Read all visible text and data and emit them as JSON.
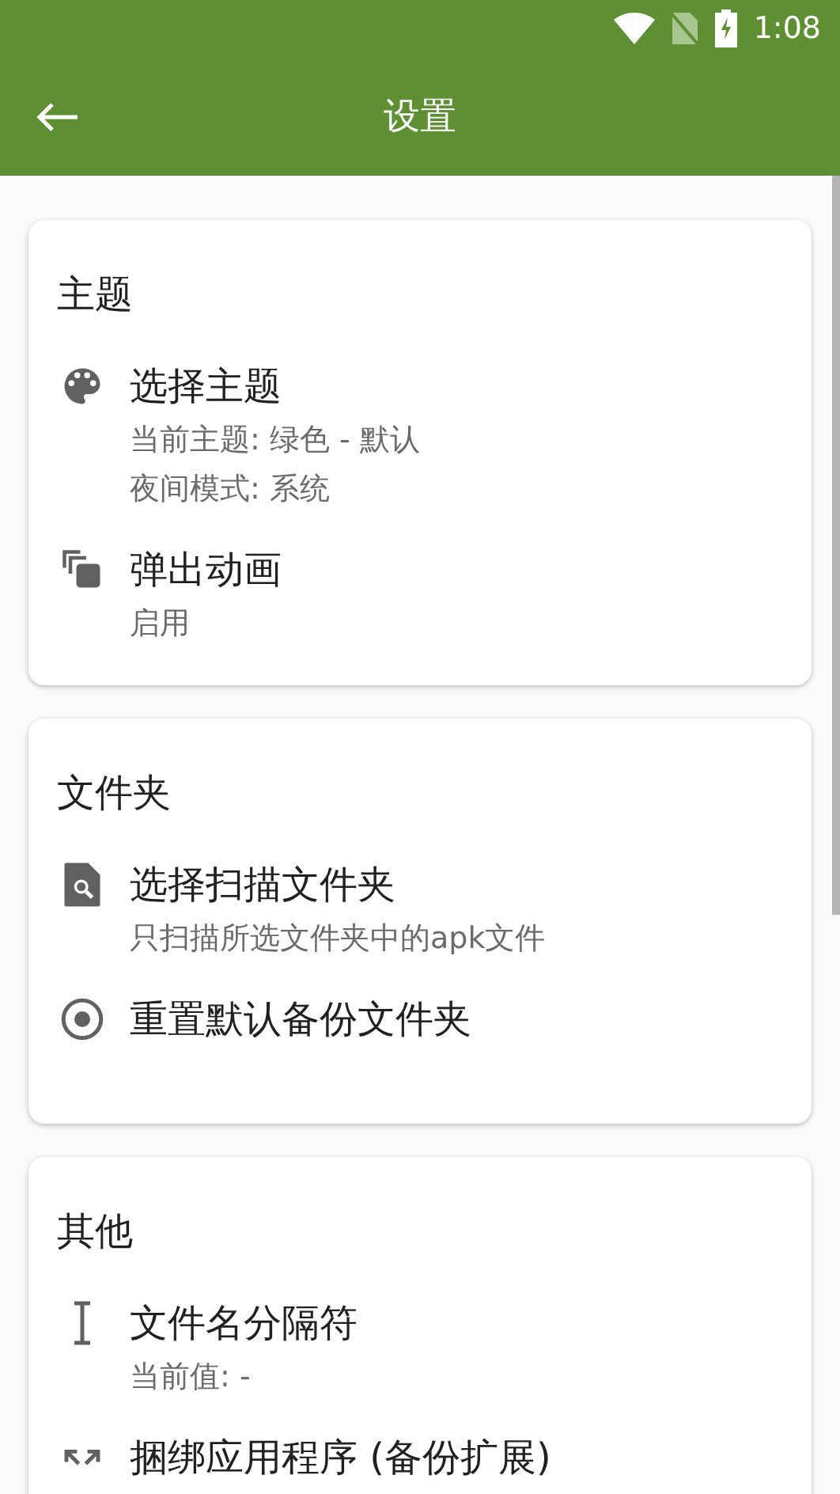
{
  "status_bar": {
    "time": "1:08"
  },
  "toolbar": {
    "title": "设置"
  },
  "sections": [
    {
      "title": "主题",
      "items": [
        {
          "title": "选择主题",
          "subtitle": [
            "当前主题: 绿色 - 默认",
            "夜间模式: 系统"
          ]
        },
        {
          "title": "弹出动画",
          "subtitle": [
            "启用"
          ]
        }
      ]
    },
    {
      "title": "文件夹",
      "items": [
        {
          "title": "选择扫描文件夹",
          "subtitle": [
            "只扫描所选文件夹中的apk文件"
          ]
        },
        {
          "title": "重置默认备份文件夹"
        }
      ]
    },
    {
      "title": "其他",
      "items": [
        {
          "title": "文件名分隔符",
          "subtitle": [
            "当前值: -"
          ]
        },
        {
          "title": "捆绑应用程序 (备份扩展)"
        }
      ]
    }
  ]
}
